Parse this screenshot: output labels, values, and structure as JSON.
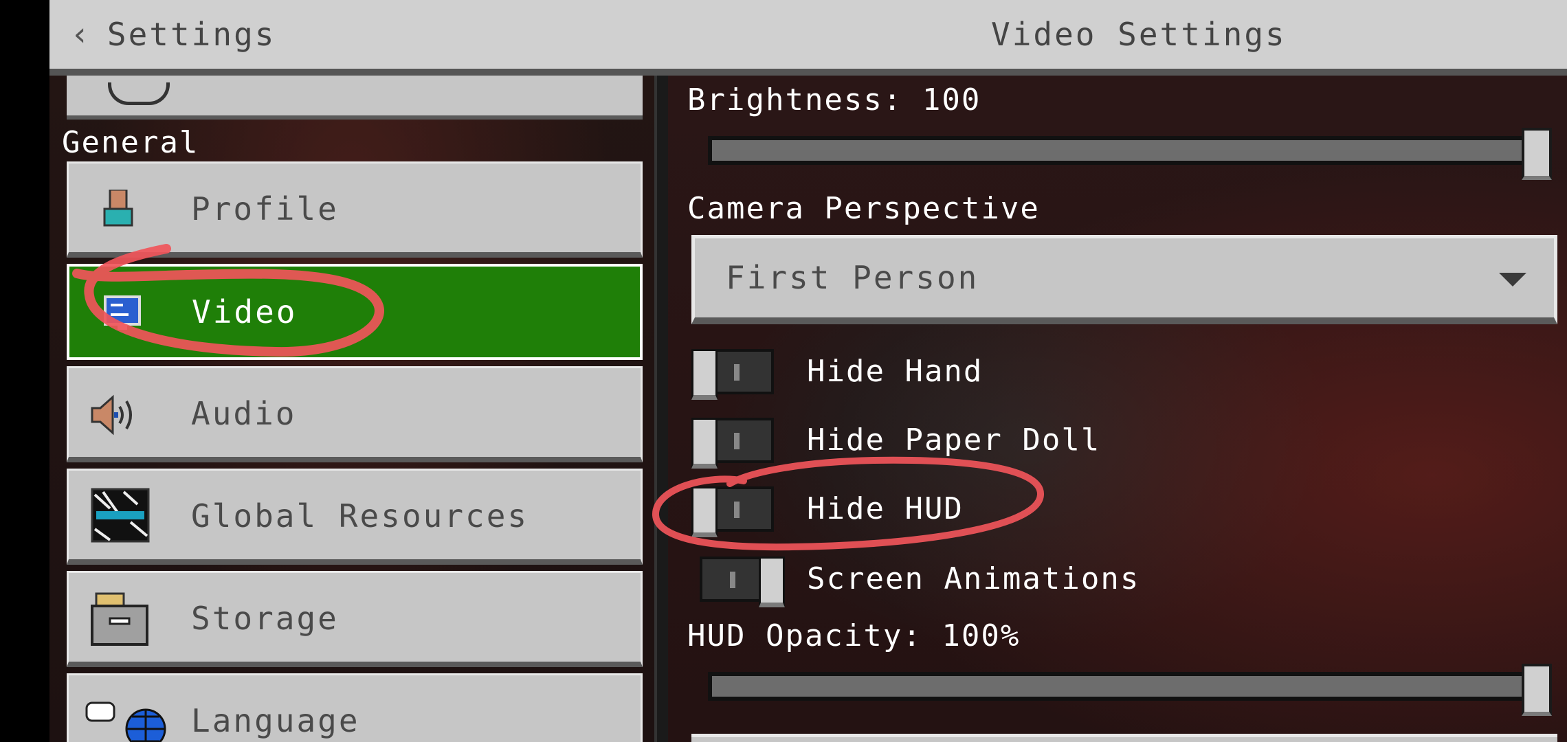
{
  "header": {
    "back_label": "Settings",
    "title": "Video Settings"
  },
  "sidebar": {
    "section_label": "General",
    "items": [
      {
        "label": "Profile",
        "icon": "profile-icon",
        "active": false
      },
      {
        "label": "Video",
        "icon": "video-icon",
        "active": true
      },
      {
        "label": "Audio",
        "icon": "speaker-icon",
        "active": false
      },
      {
        "label": "Global Resources",
        "icon": "resource-pack-icon",
        "active": false
      },
      {
        "label": "Storage",
        "icon": "storage-icon",
        "active": false
      },
      {
        "label": "Language",
        "icon": "language-icon",
        "active": false
      }
    ]
  },
  "video": {
    "brightness_label": "Brightness: 100",
    "brightness_value": 100,
    "camera_label": "Camera Perspective",
    "camera_value": "First Person",
    "toggles": [
      {
        "label": "Hide Hand",
        "on": false
      },
      {
        "label": "Hide Paper Doll",
        "on": false
      },
      {
        "label": "Hide HUD",
        "on": false
      },
      {
        "label": "Screen Animations",
        "on": true
      }
    ],
    "hud_opacity_label": "HUD Opacity: 100%",
    "hud_opacity_value": 100
  },
  "colors": {
    "active_green": "#1f7f08",
    "annotation_red": "#f0555a",
    "button_gray": "#c6c6c6"
  }
}
